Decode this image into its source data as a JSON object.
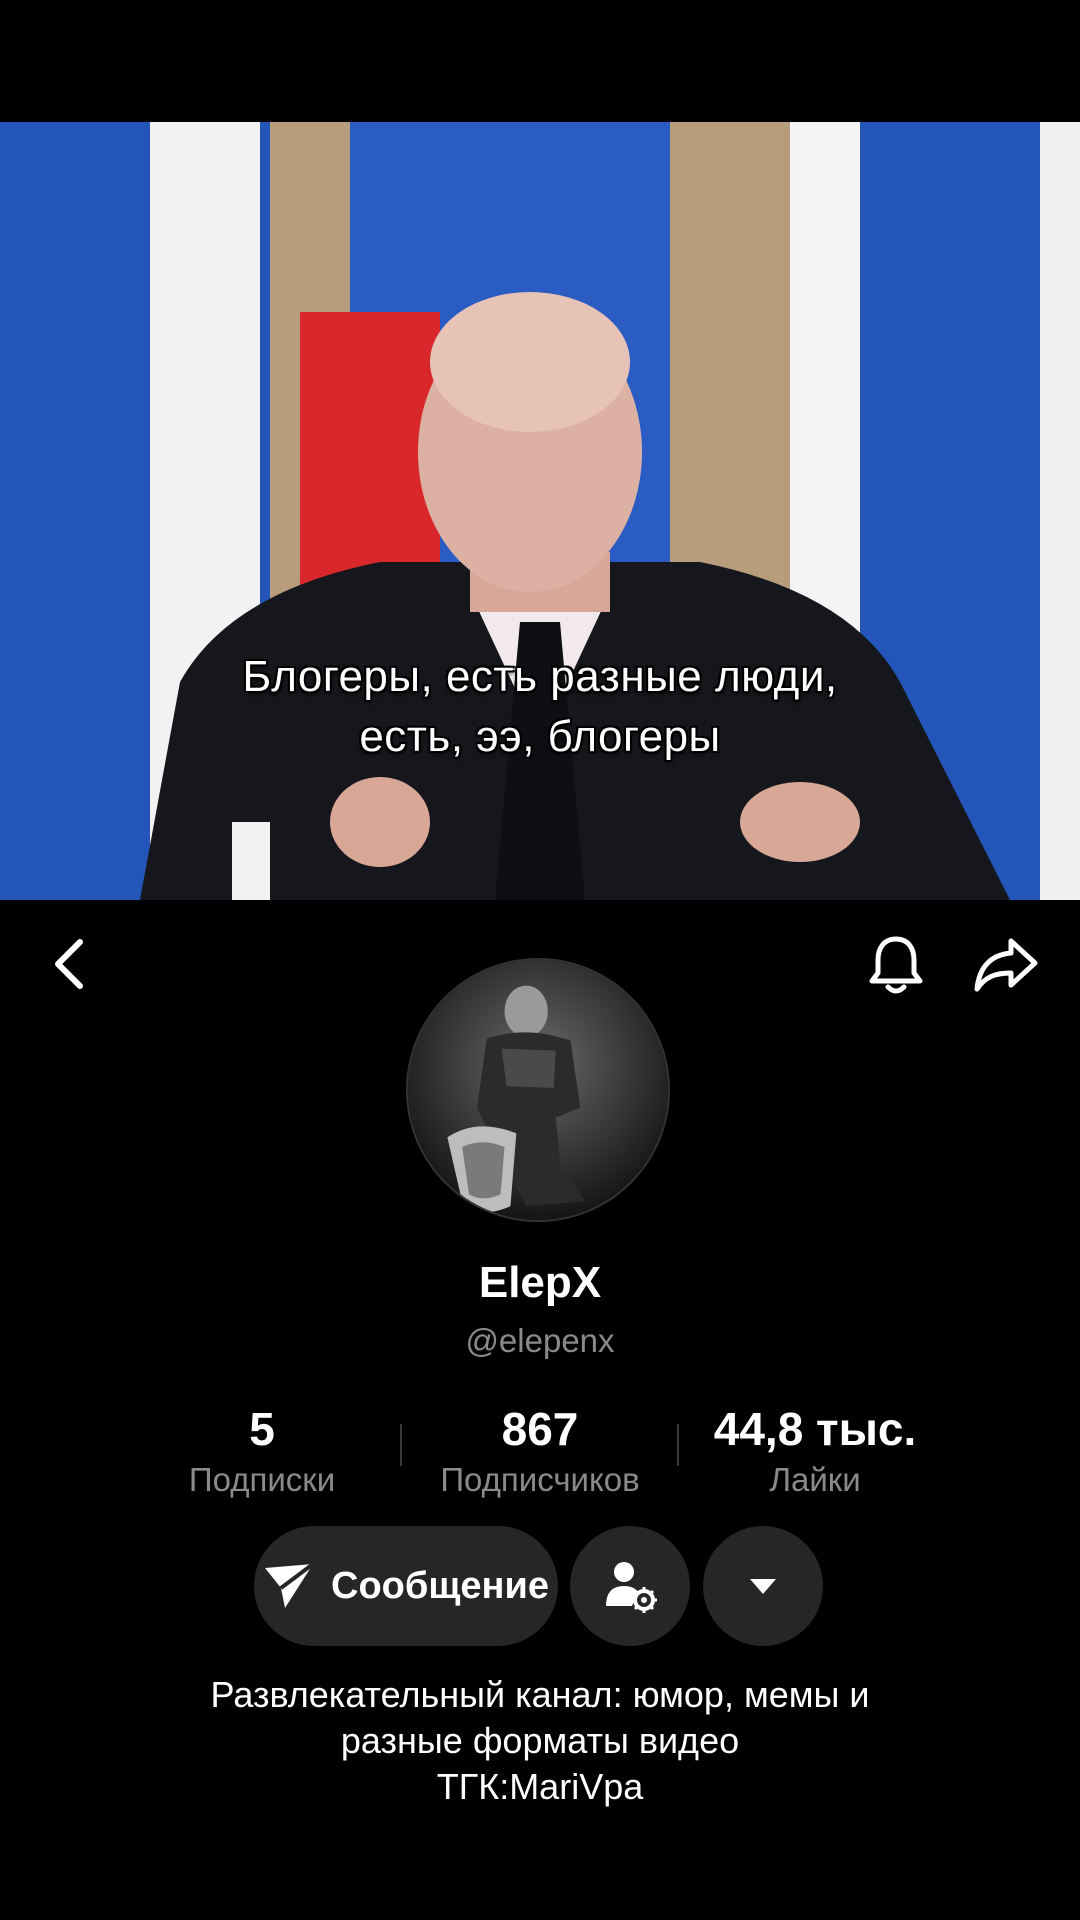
{
  "video": {
    "subtitle_line1": "Блогеры, есть разные люди,",
    "subtitle_line2": "есть, ээ, блогеры"
  },
  "topbar": {
    "back_icon": "chevron-left-icon",
    "bell_icon": "bell-icon",
    "share_icon": "share-arrow-icon"
  },
  "profile": {
    "display_name": "ElepX",
    "handle": "@elepenx"
  },
  "stats": [
    {
      "value": "5",
      "label": "Подписки"
    },
    {
      "value": "867",
      "label": "Подписчиков"
    },
    {
      "value": "44,8 тыс.",
      "label": "Лайки"
    }
  ],
  "actions": {
    "message_label": "Сообщение",
    "message_icon": "send-icon",
    "friend_icon": "user-settings-icon",
    "more_icon": "caret-down-icon"
  },
  "bio": {
    "line1": "Развлекательный канал: юмор, мемы и",
    "line2": "разные форматы видео",
    "line3": "ТГК:MariVpa"
  },
  "colors": {
    "background": "#000000",
    "button_bg": "#262626",
    "secondary_text": "#8a8a8a",
    "flag_blue": "#1f4fae",
    "flag_red": "#d8282b"
  }
}
